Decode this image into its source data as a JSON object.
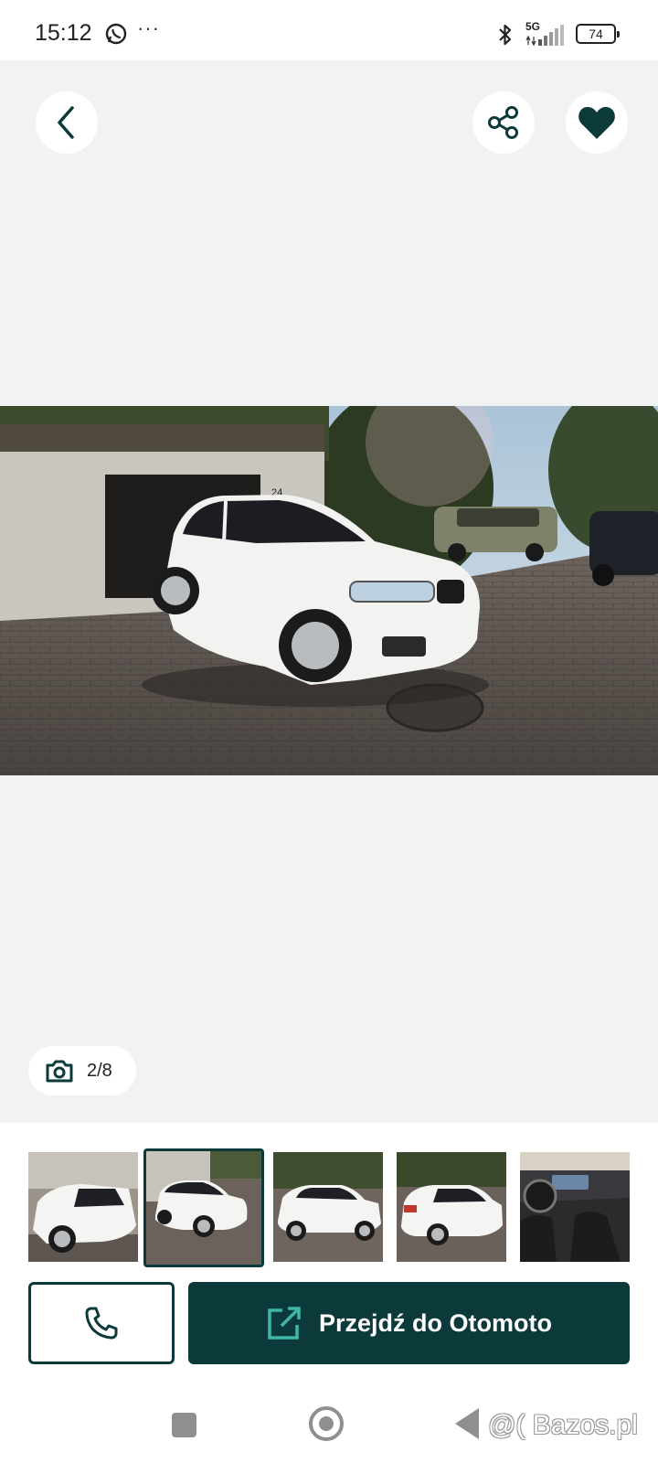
{
  "status_bar": {
    "time": "15:12",
    "notification_icons": [
      "whatsapp-icon",
      "more-dots-icon"
    ],
    "more_dots": "···",
    "network": "5G",
    "battery": "74"
  },
  "top_actions": {
    "back_icon": "chevron-left-icon",
    "share_icon": "share-icon",
    "favorite_icon": "heart-icon"
  },
  "gallery": {
    "current_image": "white BMW X5 SUV parked on brick-paved driveway",
    "counter": "2/8",
    "camera_icon": "camera-icon"
  },
  "thumbnails": [
    {
      "label": "front view of white BMW X5",
      "selected": false
    },
    {
      "label": "front quarter view of white BMW X5",
      "selected": true
    },
    {
      "label": "side view of white BMW X5",
      "selected": false
    },
    {
      "label": "rear quarter view of white BMW X5",
      "selected": false
    },
    {
      "label": "interior dashboard and seats",
      "selected": false
    }
  ],
  "actions": {
    "call_icon": "phone-icon",
    "cta_icon": "external-link-icon",
    "cta_label": "Przejdź do Otomoto"
  },
  "navbar": {
    "watermark": "@( Bazos.pl"
  },
  "colors": {
    "brand_dark": "#0c3a3a",
    "accent_teal": "#3fb6a8",
    "background": "#f1f2f4"
  }
}
